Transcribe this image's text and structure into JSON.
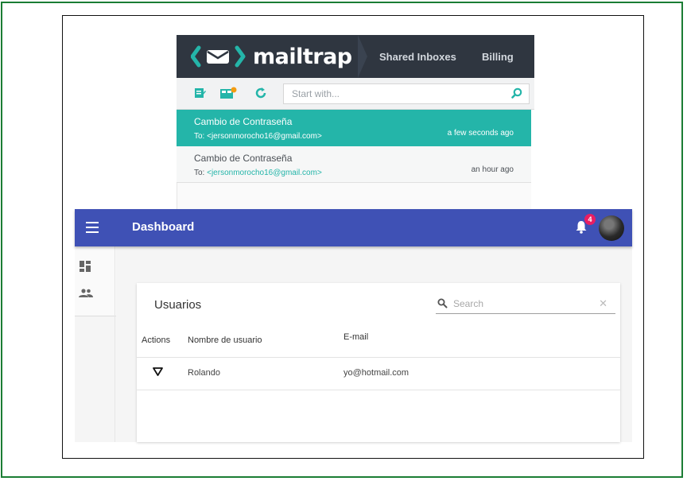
{
  "mailtrap": {
    "brand": "mailtrap",
    "nav": {
      "shared": "Shared Inboxes",
      "billing": "Billing"
    },
    "search_placeholder": "Start with...",
    "messages": [
      {
        "subject": "Cambio de Contraseña",
        "to_prefix": "To: ",
        "to": "<jersonmorocho16@gmail.com>",
        "time": "a few seconds ago",
        "active": true
      },
      {
        "subject": "Cambio de Contraseña",
        "to_prefix": "To: ",
        "to": "<jersonmorocho16@gmail.com>",
        "time": "an hour ago",
        "active": false
      }
    ],
    "colors": {
      "header": "#2f3640",
      "accent": "#24b5a9"
    }
  },
  "dashboard": {
    "title": "Dashboard",
    "notifications": "4",
    "card_title": "Usuarios",
    "search_placeholder": "Search",
    "columns": {
      "actions": "Actions",
      "name": "Nombre de usuario",
      "email": "E-mail"
    },
    "rows": [
      {
        "name": "Rolando",
        "email": "yo@hotmail.com"
      }
    ],
    "colors": {
      "appbar": "#3f51b5",
      "badge": "#e91e63"
    }
  }
}
